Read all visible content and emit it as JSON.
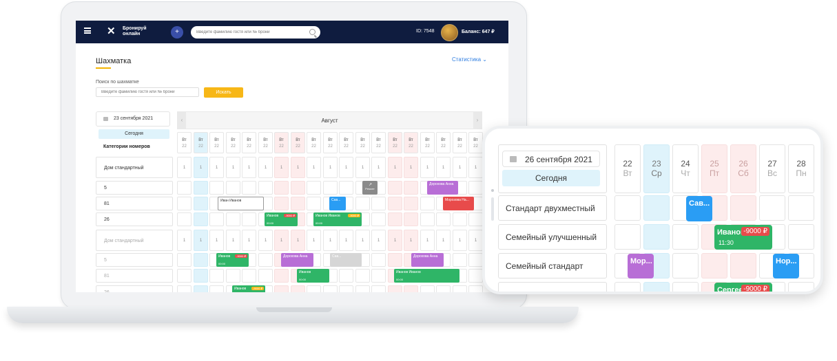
{
  "app": {
    "logo_line1": "Бронируй",
    "logo_line2": "онлайн",
    "plus_label": "+",
    "search_placeholder": "Введите фамилию гостя или № брони",
    "user_id": "ID: 7548",
    "balance": "Баланс: 647 ₽"
  },
  "page": {
    "title": "Шахматка",
    "stats_link": "Статистика",
    "search_label": "Поиск по шахматке",
    "search_placeholder": "Введите фамилию гостя или № брони",
    "search_button": "Искать"
  },
  "grid": {
    "date": "23 сентября 2021",
    "today_label": "Сегодня",
    "categories_header": "Категории номеров",
    "month": "Август",
    "prev_arrow": "‹",
    "next_arrow": "›",
    "day_name": "Вт",
    "day_number": "22",
    "avail_value": "1",
    "rows": [
      "Дом стандартный",
      "5",
      "81",
      "26",
      "Дом стандартный",
      "5",
      "81",
      "26"
    ],
    "bookings": [
      {
        "name": "Дорохова Анна",
        "time": "",
        "price": ""
      },
      {
        "name": "Ремонт",
        "time": "",
        "price": ""
      },
      {
        "name": "Иван Иванов",
        "time": "",
        "price": ""
      },
      {
        "name": "Сав...",
        "time": "",
        "price": ""
      },
      {
        "name": "Морозова На...",
        "time": "",
        "price": ""
      },
      {
        "name": "Иванов",
        "time": "00:00",
        "price": "-9000 ₽"
      },
      {
        "name": "Иванов Иванов",
        "time": "00:00",
        "price": "-9000 ₽"
      },
      {
        "name": "Иванов",
        "time": "00:00",
        "price": "-9000 ₽"
      },
      {
        "name": "Дорохова Анна",
        "time": "",
        "price": ""
      },
      {
        "name": "Сав...",
        "time": "",
        "price": ""
      },
      {
        "name": "Дорохова Анна",
        "time": "",
        "price": ""
      },
      {
        "name": "Иванов",
        "time": "00:00",
        "price": ""
      },
      {
        "name": "Иванов Иванов",
        "time": "00:00",
        "price": ""
      },
      {
        "name": "Иванов",
        "time": "",
        "price": "-9000 ₽"
      }
    ]
  },
  "phone": {
    "date": "26 сентября 2021",
    "today_label": "Сегодня",
    "days": [
      {
        "num": "22",
        "name": "Вт"
      },
      {
        "num": "23",
        "name": "Ср"
      },
      {
        "num": "24",
        "name": "Чт"
      },
      {
        "num": "25",
        "name": "Пт"
      },
      {
        "num": "26",
        "name": "Сб"
      },
      {
        "num": "27",
        "name": "Вс"
      },
      {
        "num": "28",
        "name": "Пн"
      }
    ],
    "rows": [
      "Стандарт двухместный",
      "Семейный улучшенный",
      "Семейный стандарт"
    ],
    "bookings": [
      {
        "name": "Сав...",
        "time": "",
        "price": ""
      },
      {
        "name": "Иванов",
        "time": "11:30",
        "price": "-9000 ₽"
      },
      {
        "name": "Мор...",
        "time": "",
        "price": ""
      },
      {
        "name": "Нор...",
        "time": "",
        "price": ""
      },
      {
        "name": "Сергеев",
        "time": "",
        "price": "-9000 ₽"
      }
    ]
  },
  "colors": {
    "navy": "#0f1c3f",
    "yellow": "#f7b717",
    "green": "#2fb567",
    "blue": "#2a9df4",
    "purple": "#b86ed6",
    "red": "#e84b4b",
    "grey": "#8a8a8a",
    "today_bg": "#dff3fb",
    "weekend_bg": "#fdecec"
  }
}
